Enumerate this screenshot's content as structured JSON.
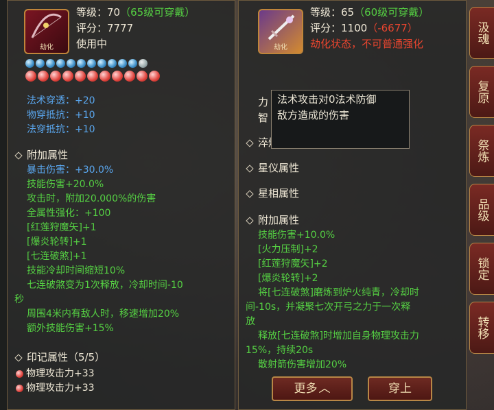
{
  "left_item": {
    "icon_name": "bow-weapon-icon",
    "icon_tag": "劫化",
    "level_label": "等级：",
    "level_value": "70",
    "level_req": "（65级可穿戴）",
    "score_label": "评分：",
    "score_value": "7777",
    "status": "使用中",
    "stats": [
      "法术穿透：+20",
      "物穿抵抗：+10",
      "法穿抵抗：+10"
    ],
    "extra_title": "附加属性",
    "extra_lines": [
      {
        "text": "暴击伤害：+30.0%",
        "color": "blue"
      },
      {
        "text": "技能伤害+20.0%",
        "color": "green"
      },
      {
        "text": "攻击时，附加20.000%的伤害",
        "color": "green"
      },
      {
        "text": "全属性强化：+100",
        "color": "green"
      },
      {
        "text": "[红莲狩魔矢]+1",
        "color": "green"
      },
      {
        "text": "[爆炎轮转]+1",
        "color": "green"
      },
      {
        "text": "[七连破煞]+1",
        "color": "green"
      },
      {
        "text": "技能冷却时间缩短10%",
        "color": "green"
      },
      {
        "text": "七连破煞变为1次释放，冷却时间-10",
        "color": "green"
      },
      {
        "text": "秒",
        "color": "green"
      },
      {
        "text": "周围4米内有敌人时，移速增加20%",
        "color": "green"
      },
      {
        "text": "额外技能伤害+15%",
        "color": "green"
      }
    ],
    "mark_title": "印记属性（5/5）",
    "marks": [
      "物理攻击力+33",
      "物理攻击力+33"
    ]
  },
  "right_item": {
    "icon_name": "sword-weapon-icon",
    "icon_tag": "劫化",
    "level_label": "等级：",
    "level_value": "65",
    "level_req": "（60级可穿戴）",
    "score_label": "评分：",
    "score_value": "1100",
    "score_diff": "（-6677）",
    "status": "劫化状态，不可普通强化",
    "partial_a": "力",
    "partial_b": "智",
    "sections": [
      "淬炼属性",
      "星仪属性",
      "星相属性"
    ],
    "extra_title": "附加属性",
    "extra_lines": [
      "技能伤害+10.0%",
      "[火力压制]+2",
      "[红莲狩魔矢]+2",
      "[爆炎轮转]+2",
      "将[七连破煞]磨炼到炉火纯青，冷却时",
      "间-10s，并凝聚七次开弓之力于一次释",
      "放",
      "释放[七连破煞]时增加自身物理攻击力",
      "15%，持续20s",
      "散射箭伤害增加20%"
    ],
    "more_button": "更多",
    "wear_button": "穿上"
  },
  "tooltip": {
    "lines": [
      "法术攻击对0法术防御",
      "敌方造成的伤害"
    ]
  },
  "side_buttons": [
    "汲魂",
    "复原",
    "祭炼",
    "品级",
    "锁定",
    "转移"
  ],
  "colors": {
    "green": "#55d043",
    "red": "#e8452f",
    "blue": "#5aa7ef",
    "gold": "#b88746"
  }
}
